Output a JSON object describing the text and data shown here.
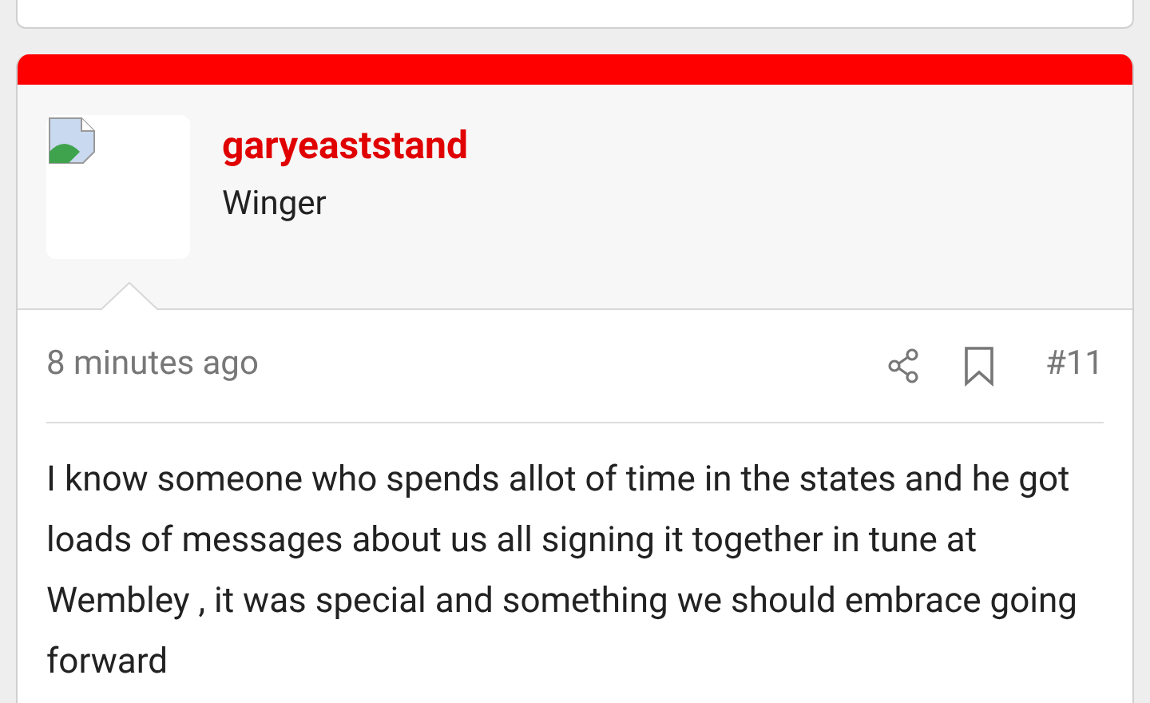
{
  "post": {
    "username": "garyeaststand",
    "user_title": "Winger",
    "time": "8 minutes ago",
    "number": "#11",
    "body": "I know someone who spends allot of time in the states and he got loads of messages about us all signing it together in tune at Wembley , it was special and something we should embrace going forward"
  }
}
